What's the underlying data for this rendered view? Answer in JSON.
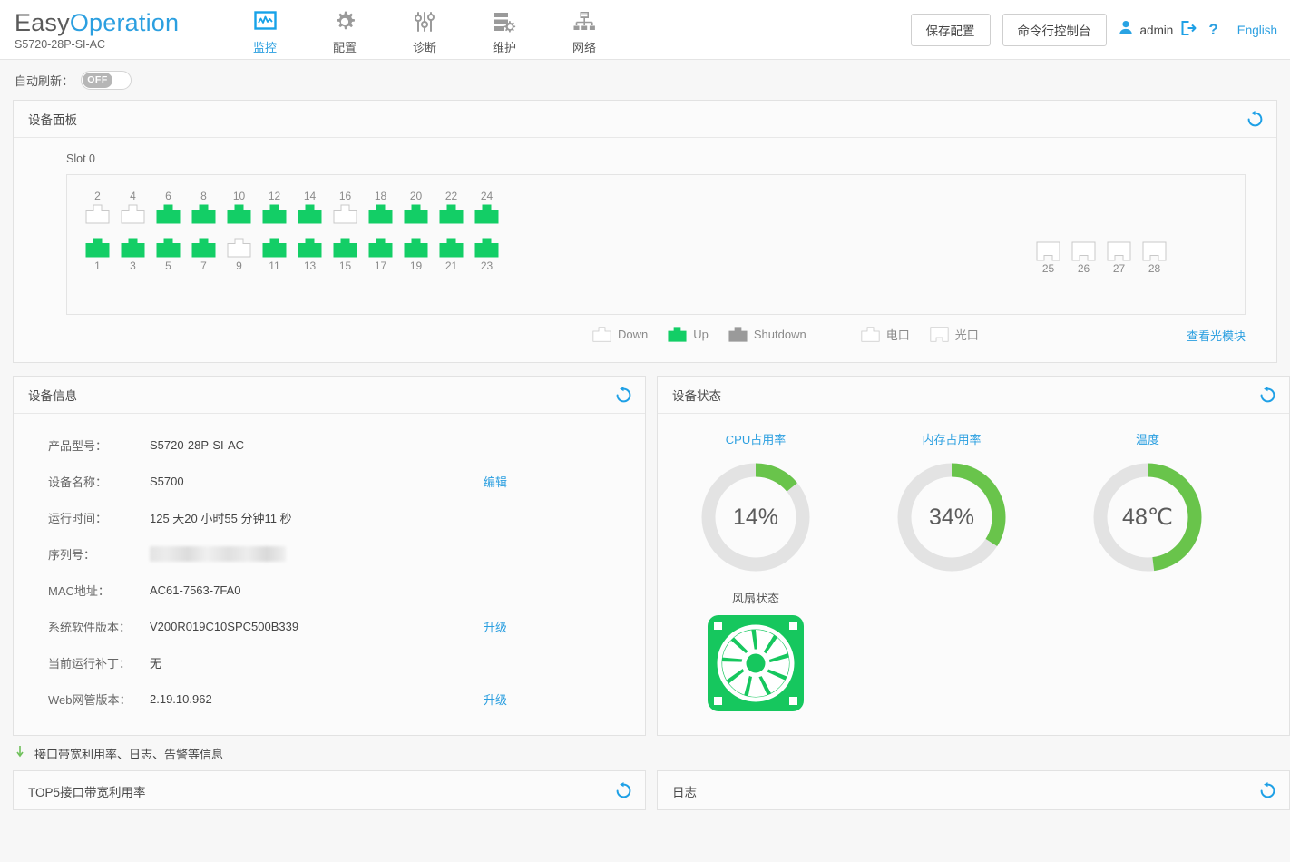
{
  "header": {
    "brand_easy": "Easy",
    "brand_operation": "Operation",
    "model_sub": "S5720-28P-SI-AC",
    "nav": [
      {
        "label": "监控",
        "icon": "monitor-icon",
        "active": true
      },
      {
        "label": "配置",
        "icon": "gear-icon",
        "active": false
      },
      {
        "label": "诊断",
        "icon": "sliders-icon",
        "active": false
      },
      {
        "label": "维护",
        "icon": "maintenance-icon",
        "active": false
      },
      {
        "label": "网络",
        "icon": "network-icon",
        "active": false
      }
    ],
    "save_config_label": "保存配置",
    "cli_console_label": "命令行控制台",
    "user_name": "admin",
    "logout_icon": "logout-icon",
    "help_icon": "question-mark-icon",
    "language_label": "English"
  },
  "auto_refresh": {
    "label": "自动刷新：",
    "state_text": "OFF",
    "enabled": false
  },
  "device_panel": {
    "title": "设备面板",
    "slot_label": "Slot 0",
    "refresh_icon": "refresh-icon",
    "top_row_numbers": [
      "2",
      "4",
      "6",
      "8",
      "10",
      "12",
      "14",
      "16",
      "18",
      "20",
      "22",
      "24"
    ],
    "top_row_states": [
      "down",
      "down",
      "up",
      "up",
      "up",
      "up",
      "up",
      "down",
      "up",
      "up",
      "up",
      "up"
    ],
    "bottom_row_numbers": [
      "1",
      "3",
      "5",
      "7",
      "9",
      "11",
      "13",
      "15",
      "17",
      "19",
      "21",
      "23"
    ],
    "bottom_row_states": [
      "up",
      "up",
      "up",
      "up",
      "down",
      "up",
      "up",
      "up",
      "up",
      "up",
      "up",
      "up"
    ],
    "sfp_numbers": [
      "25",
      "26",
      "27",
      "28"
    ],
    "sfp_states": [
      "down",
      "down",
      "down",
      "down"
    ],
    "legend": [
      {
        "label": "Down",
        "type": "rj45",
        "state": "down"
      },
      {
        "label": "Up",
        "type": "rj45",
        "state": "up"
      },
      {
        "label": "Shutdown",
        "type": "rj45",
        "state": "shutdown"
      }
    ],
    "legend_types": [
      {
        "label": "电口",
        "type": "rj45"
      },
      {
        "label": "光口",
        "type": "sfp"
      }
    ],
    "optical_link_label": "查看光模块",
    "colors": {
      "up": "#13CE66",
      "down_stroke": "#c9c9c9",
      "shutdown": "#9a9a9a"
    }
  },
  "device_info": {
    "title": "设备信息",
    "refresh_icon": "refresh-icon",
    "rows": [
      {
        "key": "产品型号：",
        "value": "S5720-28P-SI-AC",
        "action": ""
      },
      {
        "key": "设备名称：",
        "value": "S5700",
        "action": "编辑"
      },
      {
        "key": "运行时间：",
        "value": "125 天20 小时55 分钟11 秒",
        "action": ""
      },
      {
        "key": "序列号：",
        "value": "",
        "masked": true,
        "action": ""
      },
      {
        "key": "MAC地址：",
        "value": "AC61-7563-7FA0",
        "action": ""
      },
      {
        "key": "系统软件版本：",
        "value": "V200R019C10SPC500B339",
        "action": "升级"
      },
      {
        "key": "当前运行补丁：",
        "value": "无",
        "action": ""
      },
      {
        "key": "Web网管版本：",
        "value": "2.19.10.962",
        "action": "升级"
      }
    ]
  },
  "device_status": {
    "title": "设备状态",
    "refresh_icon": "refresh-icon",
    "gauges": [
      {
        "title": "CPU占用率",
        "display": "14%",
        "percent": 14
      },
      {
        "title": "内存占用率",
        "display": "34%",
        "percent": 34
      },
      {
        "title": "温度",
        "display": "48℃",
        "percent": 48
      }
    ],
    "fan": {
      "title": "风扇状态",
      "icon": "fan-icon",
      "color": "#16C75E"
    },
    "gauge_colors": {
      "track": "#e3e3e3",
      "fill": "#69C44B"
    }
  },
  "collapse_section": {
    "arrow_icon": "arrow-down-icon",
    "label": "接口带宽利用率、日志、告警等信息"
  },
  "bottom_panels": [
    {
      "title": "TOP5接口带宽利用率",
      "refresh_icon": "refresh-icon"
    },
    {
      "title": "日志",
      "refresh_icon": "refresh-icon"
    }
  ]
}
